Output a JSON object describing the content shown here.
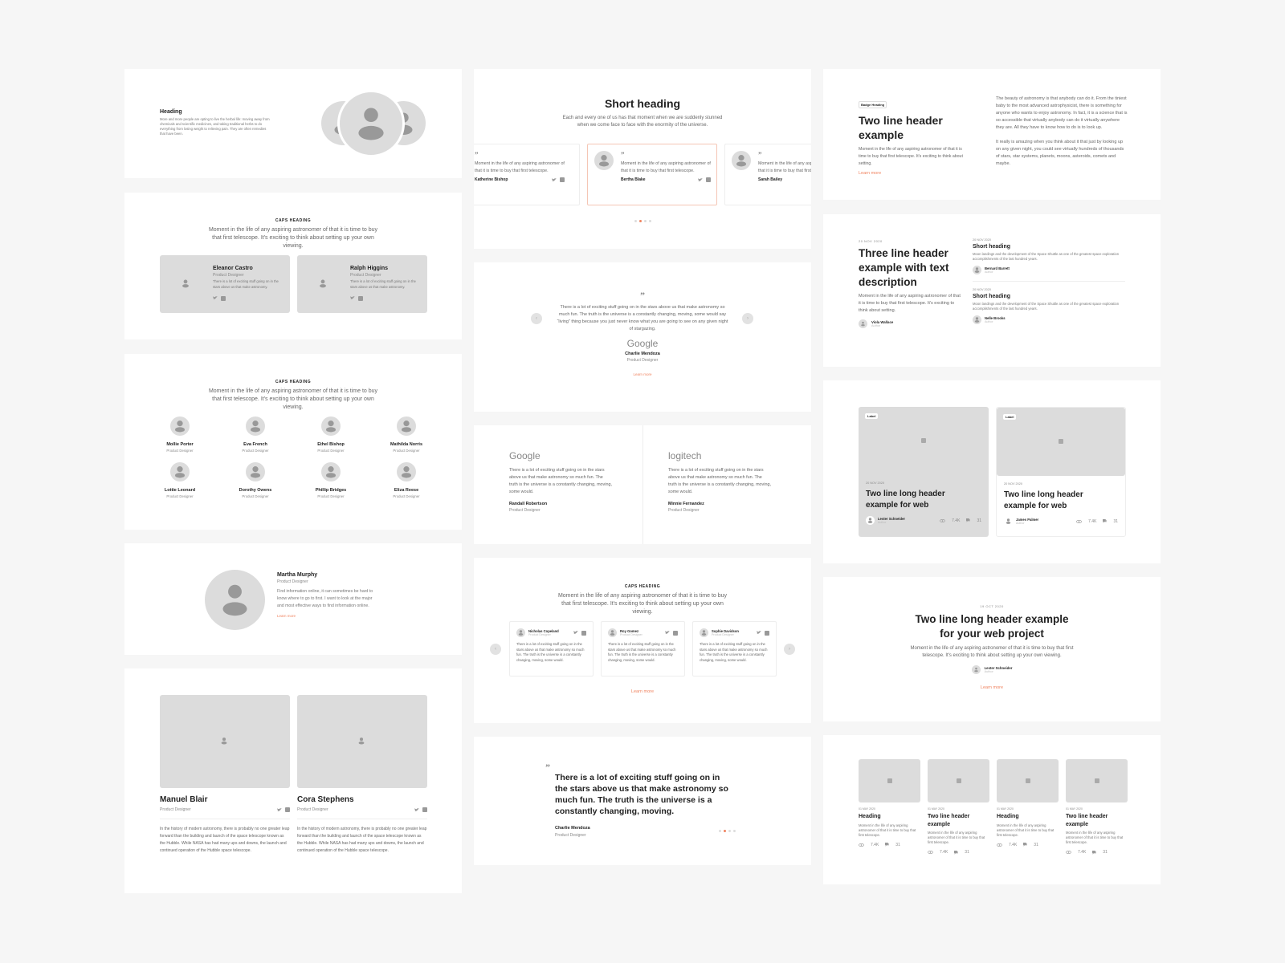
{
  "colors": {
    "accent": "#f0835f",
    "placeholder": "#dcdcdc",
    "icon": "#999999",
    "background": "#f6f6f6"
  },
  "c1": {
    "hero": {
      "heading": "Heading",
      "text": "More and more people are opting to live the herbal life: moving away from chemicals and scientific medicines, and taking traditional herbs to do everything from losing weight to relieving pain. They are often remedies that have been."
    },
    "two_cards": {
      "caps": "CAPS HEADING",
      "lead": "Moment in the life of any aspiring astronomer of that it is time to buy that first telescope. It's exciting to think about setting up your own viewing.",
      "people": [
        {
          "name": "Eleanor Castro",
          "role": "Product Designer",
          "text": "There is a lot of exciting stuff going on in the stars above us that make astronomy."
        },
        {
          "name": "Ralph Higgins",
          "role": "Product Designer",
          "text": "There is a lot of exciting stuff going on in the stars above us that make astronomy."
        }
      ]
    },
    "grid": {
      "caps": "CAPS HEADING",
      "lead": "Moment in the life of any aspiring astronomer of that it is time to buy that first telescope. It's exciting to think about setting up your own viewing.",
      "people": [
        {
          "name": "Mollie Porter",
          "role": "Product Designer"
        },
        {
          "name": "Eva French",
          "role": "Product Designer"
        },
        {
          "name": "Ethel Bishop",
          "role": "Product Designer"
        },
        {
          "name": "Mathilda Norris",
          "role": "Product Designer"
        },
        {
          "name": "Lottie Leonard",
          "role": "Product Designer"
        },
        {
          "name": "Dorothy Owens",
          "role": "Product Designer"
        },
        {
          "name": "Phillip Bridges",
          "role": "Product Designer"
        },
        {
          "name": "Eliza Reese",
          "role": "Product Designer"
        }
      ]
    },
    "profile": {
      "name": "Martha Murphy",
      "role": "Product Designer",
      "text": "Find information online, it can sometimes be hard to know where to go to first. I want to look at the major and most effective ways to find information online.",
      "link": "Learn more"
    },
    "big_people": [
      {
        "name": "Manuel Blair",
        "role": "Product Designer",
        "text": "In the history of modern astronomy, there is probably no one greater leap forward than the building and launch of the space telescope known as the Hubble. While NASA has had many ups and downs, the launch and continued operation of the Hubble space telescope."
      },
      {
        "name": "Cora Stephens",
        "role": "Product Designer",
        "text": "In the history of modern astronomy, there is probably no one greater leap forward than the building and launch of the space telescope known as the Hubble. While NASA has had many ups and downs, the launch and continued operation of the Hubble space telescope."
      }
    ]
  },
  "c2": {
    "carousel": {
      "heading": "Short heading",
      "lead": "Each and every one of us has that moment when we are suddenly stunned when we come face to face with the enormity of the universe.",
      "items": [
        {
          "name": "Katherine Bishop",
          "text": "Moment in the life of any aspiring astronomer of that it is time to buy that first telescope."
        },
        {
          "name": "Bertha Blake",
          "text": "Moment in the life of any aspiring astronomer of that it is time to buy that first telescope."
        },
        {
          "name": "Sarah Bailey",
          "text": "Moment in the life of any aspiring astronomer of that it is time to buy that first telescope."
        }
      ],
      "active_dot": 2,
      "dot_count": 4
    },
    "single": {
      "text": "There is a lot of exciting stuff going on in the stars above us that make astronomy so much fun. The truth is the universe is a constantly changing, moving, some would say “living” thing because you just never know what you are going to see on any given night of stargazing.",
      "logo": "Google",
      "name": "Charlie Mendoza",
      "role": "Product Designer",
      "link": "Learn more",
      "prev": "‹",
      "next": "›"
    },
    "logos": [
      {
        "logo": "Google",
        "text": "There is a lot of exciting stuff going on in the stars above us that make astronomy so much fun. The truth is the universe is a constantly changing, moving, some would.",
        "name": "Randall Robertson",
        "role": "Product Designer"
      },
      {
        "logo": "logitech",
        "text": "There is a lot of exciting stuff going on in the stars above us that make astronomy so much fun. The truth is the universe is a constantly changing, moving, some would.",
        "name": "Minnie Fernandez",
        "role": "Product Designer"
      }
    ],
    "three": {
      "caps": "CAPS HEADING",
      "lead": "Moment in the life of any aspiring astronomer of that it is time to buy that first telescope. It's exciting to think about setting up your own viewing.",
      "items": [
        {
          "name": "Nicholas Copeland",
          "role": "Product Designer",
          "text": "There is a lot of exciting stuff going on in the stars above us that make astronomy so much fun. The truth is the universe is a constantly changing, moving, some would."
        },
        {
          "name": "Roy Gomez",
          "role": "Product Designer",
          "text": "There is a lot of exciting stuff going on in the stars above us that make astronomy so much fun. The truth is the universe is a constantly changing, moving, some would."
        },
        {
          "name": "Sophie Davidson",
          "role": "Product Designer",
          "text": "There is a lot of exciting stuff going on in the stars above us that make astronomy so much fun. The truth is the universe is a constantly changing, moving, some would."
        }
      ],
      "link": "Learn more",
      "prev": "‹",
      "next": "›"
    },
    "big_quote": {
      "text": "There is a lot of exciting stuff going on in the stars above us that make astronomy so much fun. The truth is the universe is a constantly changing, moving.",
      "name": "Charlie Mendoza",
      "role": "Product Designer",
      "active_dot": 2,
      "dot_count": 4
    }
  },
  "c3": {
    "intro": {
      "badge": "Badge Heading",
      "title": "Two line header example",
      "text": "Moment in the life of any aspiring astronomer of that it is time to buy that first telescope. It's exciting to think about setting.",
      "link": "Learn more",
      "para1": "The beauty of astronomy is that anybody can do it. From the tiniest baby to the most advanced astrophysicist, there is something for anyone who wants to enjoy astronomy. In fact, it is a science that is so accessible that virtually anybody can do it virtually anywhere they are. All they have to know how to do is to look up.",
      "para2": "It really is amazing when you think about it that just by looking up on any given night, you could see virtually hundreds of thousands of stars, star systems, planets, moons, asteroids, comets and maybe."
    },
    "blog": {
      "date": "20 NOV 2020",
      "title": "Three line header example with text description",
      "text": "Moment in the life of any aspiring astronomer of that it is time to buy that first telescope. It's exciting to think about setting.",
      "author": "Viola Wallace",
      "author_role": "Author",
      "side": [
        {
          "date": "20 NOV 2020",
          "title": "Short heading",
          "text": "Moon landings and the development of the Space Shuttle as one of the greatest space exploration accomplishments of the last hundred years.",
          "author": "Bernard Barrett",
          "author_role": "Author"
        },
        {
          "date": "20 NOV 2020",
          "title": "Short heading",
          "text": "Moon landings and the development of the Space Shuttle as one of the greatest space exploration accomplishments of the last hundred years.",
          "author": "Nelle Brooks",
          "author_role": "Author"
        }
      ]
    },
    "posts": [
      {
        "label": "Label",
        "date": "20 NOV 2020",
        "title": "Two line long header example for web",
        "author": "Lester Schneider",
        "author_role": "Author",
        "views": "7.4K",
        "comments": "31"
      },
      {
        "label": "Label",
        "date": "20 NOV 2020",
        "title": "Two line long header example for web",
        "author": "James Palmer",
        "author_role": "Author",
        "views": "7.4K",
        "comments": "31"
      }
    ],
    "feature": {
      "date": "19 OCT 2020",
      "title": "Two line long header example for your web project",
      "text": "Moment in the life of any aspiring astronomer of that it is time to buy that first telescope. It's exciting to think about setting up your own viewing.",
      "author": "Lester Schneider",
      "author_role": "Author",
      "link": "Learn more"
    },
    "small_posts": [
      {
        "date": "01 MAY 2020",
        "title": "Heading",
        "text": "Moment in the life of any aspiring astronomer of that it is time to buy that first telescope.",
        "views": "7.4K",
        "comments": "31"
      },
      {
        "date": "01 MAY 2020",
        "title": "Two line header example",
        "text": "Moment in the life of any aspiring astronomer of that it is time to buy that first telescope.",
        "views": "7.4K",
        "comments": "31"
      },
      {
        "date": "01 MAY 2020",
        "title": "Heading",
        "text": "Moment in the life of any aspiring astronomer of that it is time to buy that first telescope.",
        "views": "7.4K",
        "comments": "31"
      },
      {
        "date": "01 MAY 2020",
        "title": "Two line header example",
        "text": "Moment in the life of any aspiring astronomer of that it is time to buy that first telescope.",
        "views": "7.4K",
        "comments": "31"
      }
    ]
  }
}
